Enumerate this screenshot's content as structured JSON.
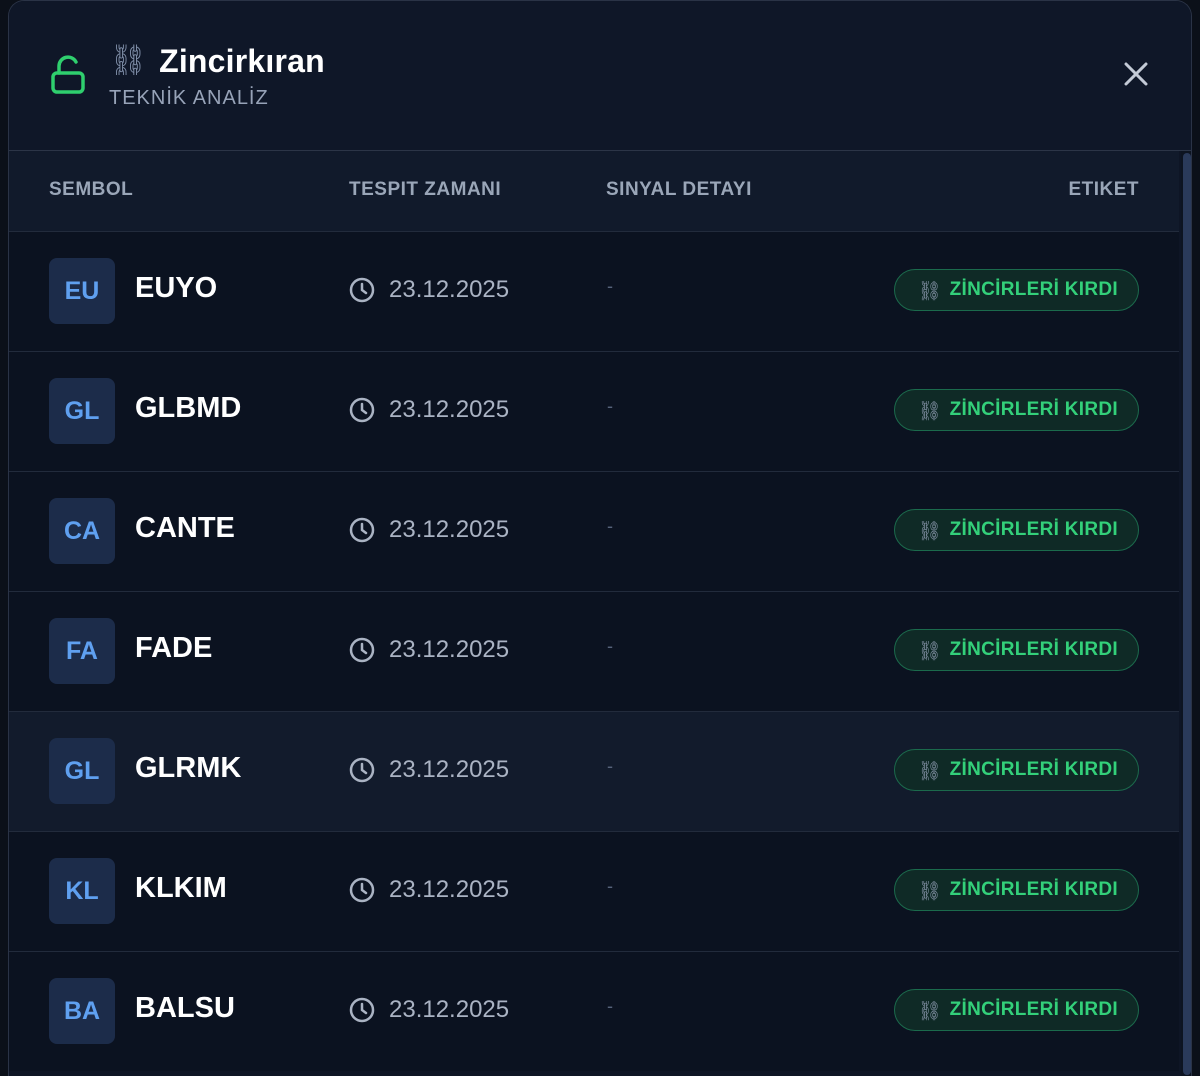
{
  "header": {
    "title": "Zincirkıran",
    "subtitle": "TEKNİK ANALİZ",
    "title_icon": "chain-icon",
    "lock_icon": "unlock-icon",
    "accent_color": "#2fcf6e"
  },
  "table": {
    "columns": [
      "SEMBOL",
      "TESPIT ZAMANI",
      "SINYAL DETAYI",
      "ETIKET"
    ],
    "rows": [
      {
        "abbr": "EU",
        "symbol": "EUYO",
        "date": "23.12.2025",
        "detail": "-",
        "tag": "ZİNCİRLERİ KIRDI"
      },
      {
        "abbr": "GL",
        "symbol": "GLBMD",
        "date": "23.12.2025",
        "detail": "-",
        "tag": "ZİNCİRLERİ KIRDI"
      },
      {
        "abbr": "CA",
        "symbol": "CANTE",
        "date": "23.12.2025",
        "detail": "-",
        "tag": "ZİNCİRLERİ KIRDI"
      },
      {
        "abbr": "FA",
        "symbol": "FADE",
        "date": "23.12.2025",
        "detail": "-",
        "tag": "ZİNCİRLERİ KIRDI"
      },
      {
        "abbr": "GL",
        "symbol": "GLRMK",
        "date": "23.12.2025",
        "detail": "-",
        "tag": "ZİNCİRLERİ KIRDI"
      },
      {
        "abbr": "KL",
        "symbol": "KLKIM",
        "date": "23.12.2025",
        "detail": "-",
        "tag": "ZİNCİRLERİ KIRDI"
      },
      {
        "abbr": "BA",
        "symbol": "BALSU",
        "date": "23.12.2025",
        "detail": "-",
        "tag": "ZİNCİRLERİ KIRDI"
      }
    ]
  }
}
